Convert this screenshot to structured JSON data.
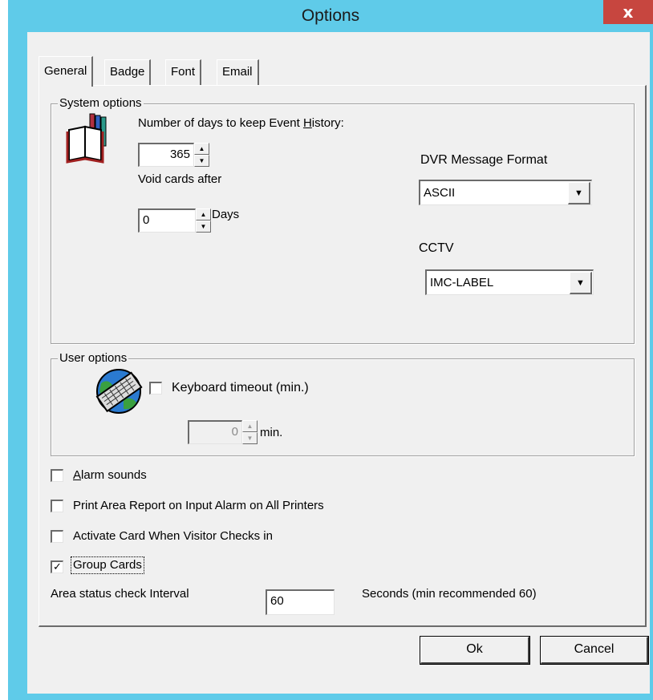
{
  "window": {
    "title": "Options",
    "close_label": "x"
  },
  "tabs": [
    {
      "label": "General"
    },
    {
      "label": "Badge"
    },
    {
      "label": "Font"
    },
    {
      "label": "Email"
    }
  ],
  "system_options": {
    "legend": "System options",
    "history_label_pre": "Number of days to keep Event ",
    "history_label_mnemonic": "H",
    "history_label_post": "istory:",
    "history_days": "365",
    "void_label": "Void cards after",
    "void_days": "0",
    "days_unit": "Days",
    "dvr_label": "DVR Message Format",
    "dvr_value": "ASCII",
    "cctv_label": "CCTV",
    "cctv_value": "IMC-LABEL"
  },
  "user_options": {
    "legend": "User options",
    "keyboard_timeout_label": "Keyboard timeout (min.)",
    "keyboard_timeout_checked": false,
    "timeout_value": "0",
    "min_unit": "min."
  },
  "checks": {
    "alarm_mnemonic": "A",
    "alarm_rest": "larm sounds",
    "alarm_checked": false,
    "print_area": "Print Area Report on Input Alarm on All Printers",
    "print_area_checked": false,
    "activate_card": "Activate Card When Visitor Checks in",
    "activate_card_checked": false,
    "group_cards": "Group Cards",
    "group_cards_checked": true
  },
  "area_status": {
    "label": "Area status check Interval",
    "value": "60",
    "hint": "Seconds (min recommended 60)"
  },
  "buttons": {
    "ok": "Ok",
    "cancel": "Cancel"
  },
  "colors": {
    "titlebar": "#5fcbe9",
    "close": "#c7463f",
    "face": "#f0f0f0"
  }
}
